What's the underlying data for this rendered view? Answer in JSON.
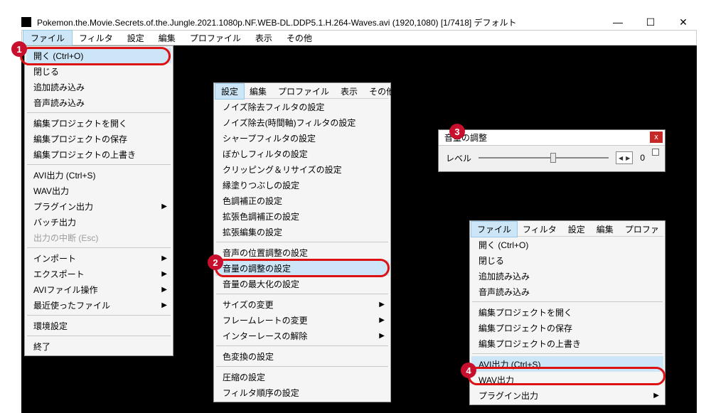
{
  "window": {
    "title": "Pokemon.the.Movie.Secrets.of.the.Jungle.2021.1080p.NF.WEB-DL.DDP5.1.H.264-Waves.avi (1920,1080)  [1/7418]  デフォルト"
  },
  "menubar": {
    "items": [
      "ファイル",
      "フィルタ",
      "設定",
      "編集",
      "プロファイル",
      "表示",
      "その他"
    ],
    "selected_index": 0
  },
  "file_menu": {
    "items": [
      {
        "label": "開く (Ctrl+O)",
        "enabled": true,
        "highlight": true,
        "sub": false
      },
      {
        "label": "閉じる",
        "enabled": true,
        "sub": false
      },
      {
        "label": "追加読み込み",
        "enabled": true,
        "sub": false
      },
      {
        "label": "音声読み込み",
        "enabled": true,
        "sub": false
      },
      {
        "sep": true
      },
      {
        "label": "編集プロジェクトを開く",
        "enabled": true,
        "sub": false
      },
      {
        "label": "編集プロジェクトの保存",
        "enabled": true,
        "sub": false
      },
      {
        "label": "編集プロジェクトの上書き",
        "enabled": true,
        "sub": false
      },
      {
        "sep": true
      },
      {
        "label": "AVI出力 (Ctrl+S)",
        "enabled": true,
        "sub": false
      },
      {
        "label": "WAV出力",
        "enabled": true,
        "sub": false
      },
      {
        "label": "プラグイン出力",
        "enabled": true,
        "sub": true
      },
      {
        "label": "バッチ出力",
        "enabled": true,
        "sub": false
      },
      {
        "label": "出力の中断 (Esc)",
        "enabled": false,
        "sub": false
      },
      {
        "sep": true
      },
      {
        "label": "インポート",
        "enabled": true,
        "sub": true
      },
      {
        "label": "エクスポート",
        "enabled": true,
        "sub": true
      },
      {
        "label": "AVIファイル操作",
        "enabled": true,
        "sub": true
      },
      {
        "label": "最近使ったファイル",
        "enabled": true,
        "sub": true
      },
      {
        "sep": true
      },
      {
        "label": "環境設定",
        "enabled": true,
        "sub": false
      },
      {
        "sep": true
      },
      {
        "label": "終了",
        "enabled": true,
        "sub": false
      }
    ]
  },
  "settings_menu": {
    "header": [
      "設定",
      "編集",
      "プロファイル",
      "表示",
      "その他"
    ],
    "header_selected_index": 0,
    "items": [
      {
        "label": "ノイズ除去フィルタの設定",
        "sub": false
      },
      {
        "label": "ノイズ除去(時間軸)フィルタの設定",
        "sub": false
      },
      {
        "label": "シャープフィルタの設定",
        "sub": false
      },
      {
        "label": "ぼかしフィルタの設定",
        "sub": false
      },
      {
        "label": "クリッピング＆リサイズの設定",
        "sub": false
      },
      {
        "label": "縁塗りつぶしの設定",
        "sub": false
      },
      {
        "label": "色調補正の設定",
        "sub": false
      },
      {
        "label": "拡張色調補正の設定",
        "sub": false
      },
      {
        "label": "拡張編集の設定",
        "sub": false
      },
      {
        "sep": true
      },
      {
        "label": "音声の位置調整の設定",
        "sub": false
      },
      {
        "label": "音量の調整の設定",
        "highlight": true,
        "sub": false
      },
      {
        "label": "音量の最大化の設定",
        "sub": false
      },
      {
        "sep": true
      },
      {
        "label": "サイズの変更",
        "sub": true
      },
      {
        "label": "フレームレートの変更",
        "sub": true
      },
      {
        "label": "インターレースの解除",
        "sub": true
      },
      {
        "sep": true
      },
      {
        "label": "色変換の設定",
        "sub": false
      },
      {
        "sep": true
      },
      {
        "label": "圧縮の設定",
        "sub": false
      },
      {
        "label": "フィルタ順序の設定",
        "sub": false
      }
    ]
  },
  "volume_dialog": {
    "title": "音量の調整",
    "label_level": "レベル",
    "value": "0"
  },
  "file_menu_small": {
    "header": [
      "ファイル",
      "フィルタ",
      "設定",
      "編集",
      "プロファ"
    ],
    "header_selected_index": 0,
    "items": [
      {
        "label": "開く (Ctrl+O)",
        "sub": false
      },
      {
        "label": "閉じる",
        "sub": false
      },
      {
        "label": "追加読み込み",
        "sub": false
      },
      {
        "label": "音声読み込み",
        "sub": false
      },
      {
        "sep": true
      },
      {
        "label": "編集プロジェクトを開く",
        "sub": false
      },
      {
        "label": "編集プロジェクトの保存",
        "sub": false
      },
      {
        "label": "編集プロジェクトの上書き",
        "sub": false
      },
      {
        "sep": true
      },
      {
        "label": "AVI出力 (Ctrl+S)",
        "highlight": true,
        "sub": false
      },
      {
        "label": "WAV出力",
        "sub": false
      },
      {
        "label": "プラグイン出力",
        "sub": true
      }
    ]
  },
  "callouts": {
    "n1": "1",
    "n2": "2",
    "n3": "3",
    "n4": "4"
  }
}
